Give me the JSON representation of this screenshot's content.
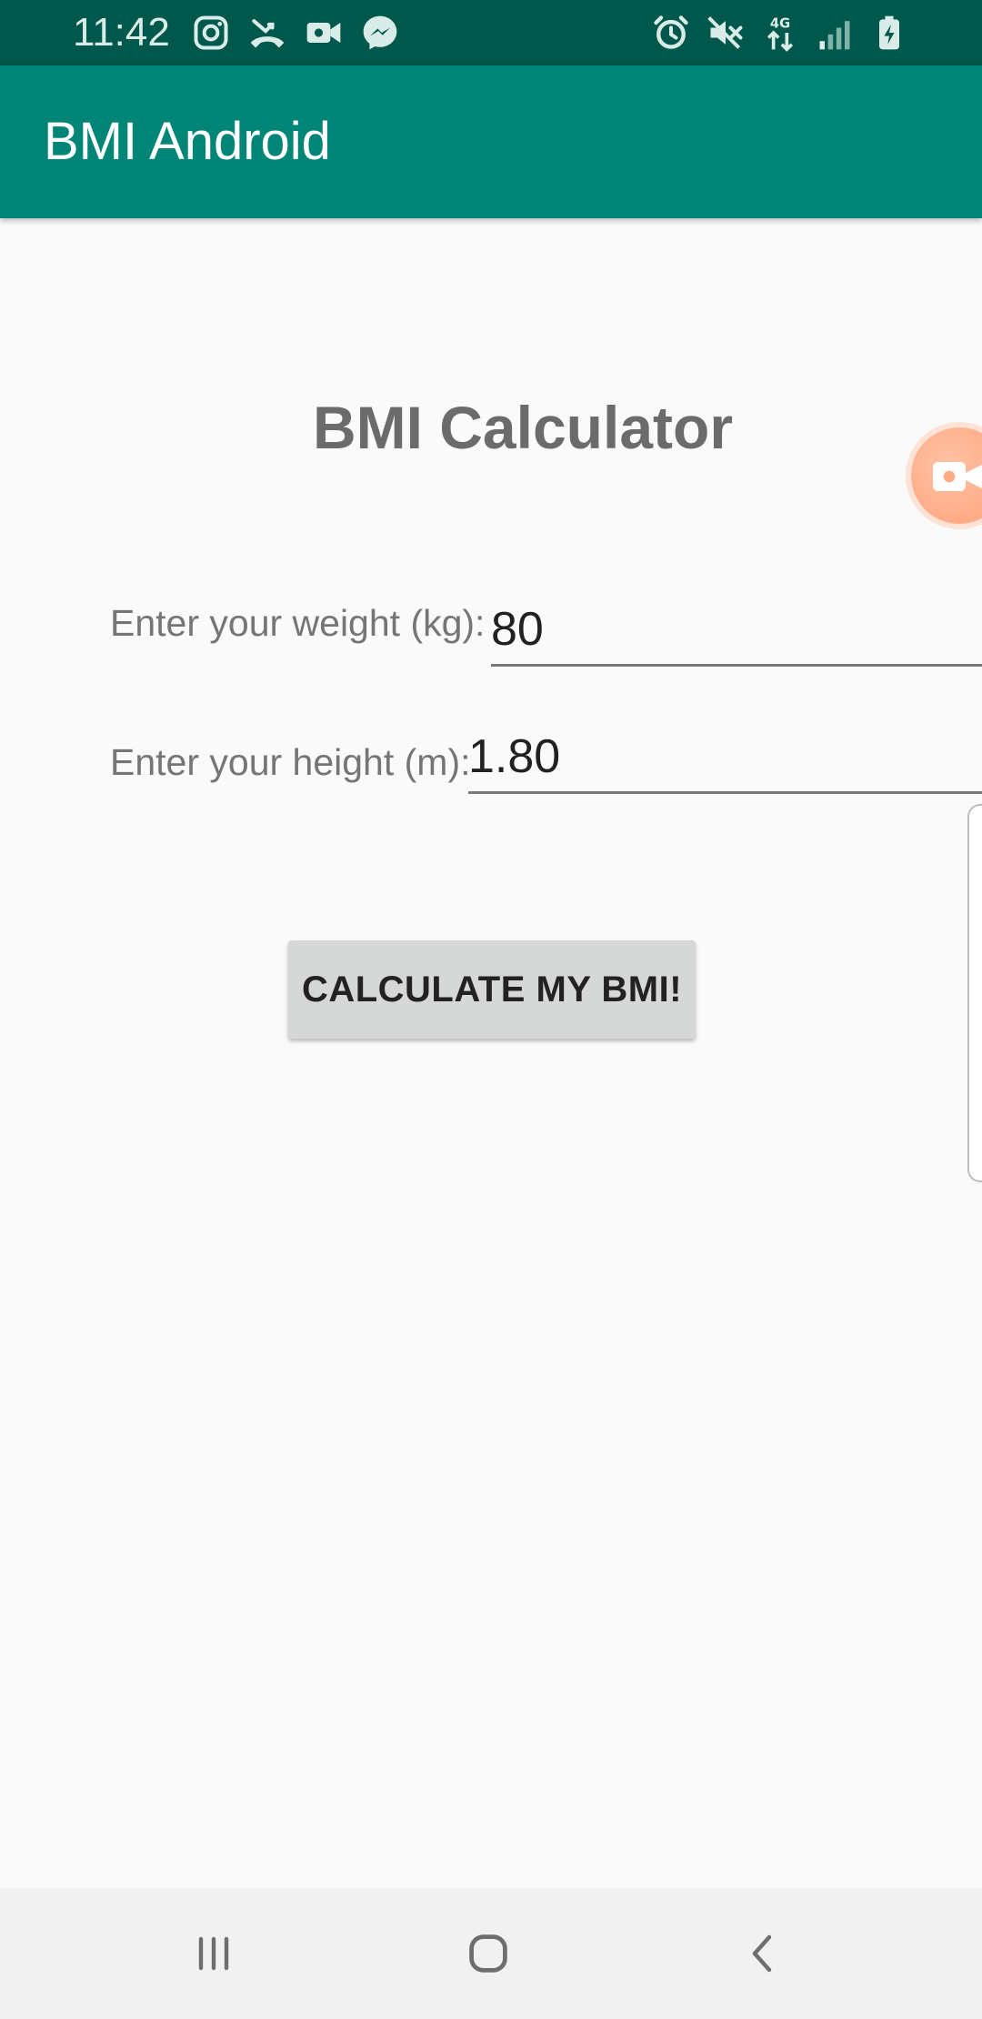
{
  "status_bar": {
    "time": "11:42",
    "left_icons": [
      "instagram-icon",
      "missed-call-icon",
      "video-camera-icon",
      "messenger-icon"
    ],
    "right_icons": [
      "alarm-icon",
      "mute-icon",
      "data-4g-icon",
      "signal-icon",
      "battery-charging-icon"
    ]
  },
  "app_bar": {
    "title": "BMI Android",
    "color": "#008577"
  },
  "main": {
    "heading": "BMI Calculator",
    "weight": {
      "label": "Enter your weight (kg):",
      "value": "80"
    },
    "height": {
      "label": "Enter your height (m):",
      "value": "1.80"
    },
    "calculate_button_label": "CALCULATE MY BMI!"
  },
  "overlays": {
    "record_bubble_icon": "video-camera-icon",
    "edge_panel_icon": "edge-panel-handle"
  },
  "nav_bar": {
    "buttons": [
      "recent-apps-icon",
      "home-icon",
      "back-icon"
    ]
  }
}
